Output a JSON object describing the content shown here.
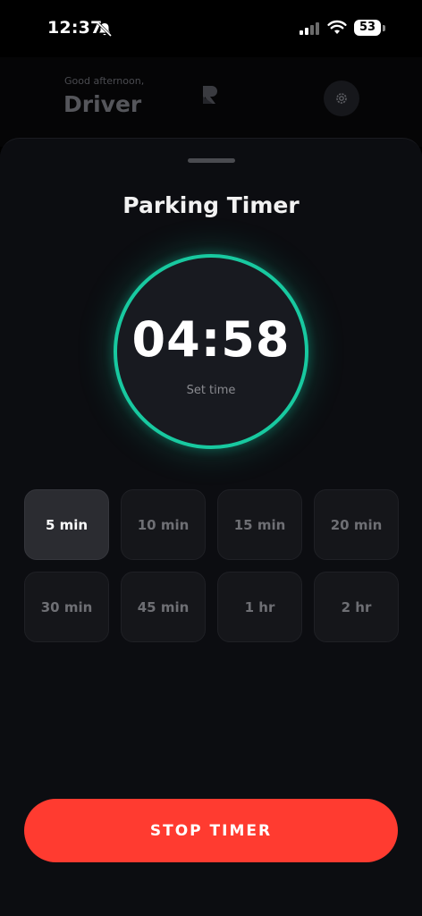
{
  "status_bar": {
    "time": "12:37",
    "battery": "53",
    "icons": [
      "bell-slash-icon",
      "signal-icon",
      "wifi-icon",
      "battery-icon"
    ]
  },
  "header": {
    "greeting": "Good afternoon,",
    "name": "Driver",
    "icons": [
      "app-logo",
      "gear-icon"
    ]
  },
  "sheet": {
    "title": "Parking Timer",
    "timer": {
      "value": "04:58",
      "label": "Set time",
      "ring_color": "#18c9a0"
    },
    "presets": [
      {
        "label": "5 min",
        "selected": true
      },
      {
        "label": "10 min",
        "selected": false
      },
      {
        "label": "15 min",
        "selected": false
      },
      {
        "label": "20 min",
        "selected": false
      },
      {
        "label": "30 min",
        "selected": false
      },
      {
        "label": "45 min",
        "selected": false
      },
      {
        "label": "1 hr",
        "selected": false
      },
      {
        "label": "2 hr",
        "selected": false
      }
    ],
    "stop_label": "STOP TIMER",
    "stop_color": "#ff3b30"
  }
}
